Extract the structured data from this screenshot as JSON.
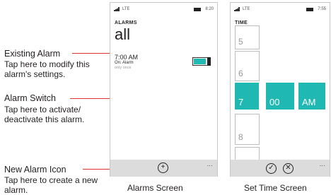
{
  "callouts": {
    "existing_alarm": {
      "title": "Existing Alarm",
      "text": "Tap here to modify this alarm's settings."
    },
    "alarm_switch": {
      "title": "Alarm Switch",
      "text": "Tap here to activate/ deactivate this alarm."
    },
    "new_alarm_icon": {
      "title": "New Alarm Icon",
      "text": "Tap here to create a new alarm."
    }
  },
  "alarms_screen": {
    "status": {
      "network": "LTE",
      "time": "8:20"
    },
    "header": "ALARMS",
    "title": "all",
    "alarm": {
      "time": "7:00 AM",
      "label": "On: Alarm",
      "repeat": "only once",
      "enabled": true
    },
    "appbar": {
      "add_icon": "plus-circle-icon",
      "more": "..."
    },
    "caption": "Alarms Screen"
  },
  "time_screen": {
    "status": {
      "network": "LTE",
      "time": "7:55"
    },
    "header": "TIME",
    "picker": {
      "above": [
        "5",
        "6"
      ],
      "hour": "7",
      "minute": "00",
      "ampm": "AM",
      "below": [
        "8"
      ]
    },
    "appbar": {
      "confirm_icon": "check-circle-icon",
      "cancel_icon": "x-circle-icon",
      "more": "..."
    },
    "caption": "Set Time Screen"
  },
  "colors": {
    "accent": "#1fb8b2",
    "callout_line": "#e0302f",
    "appbar": "#dcdcdc"
  }
}
